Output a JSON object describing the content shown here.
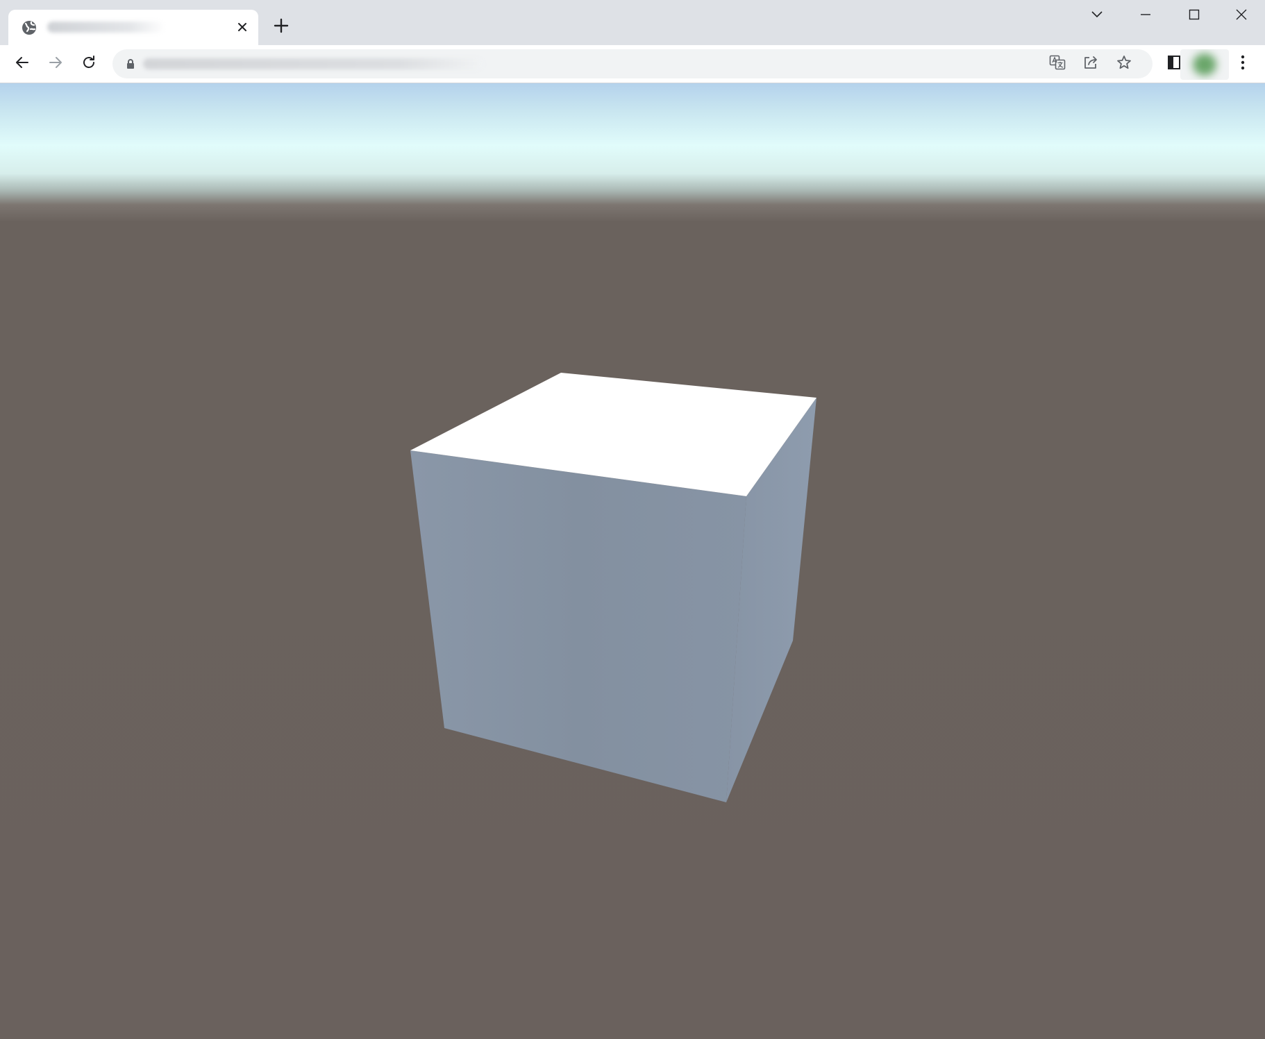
{
  "browser": {
    "tab": {
      "title": "",
      "favicon": "globe-icon",
      "close_icon": "close-icon"
    },
    "new_tab_icon": "plus-icon",
    "window_controls": [
      "tab-search-icon",
      "minimize-icon",
      "maximize-icon",
      "close-icon"
    ],
    "toolbar": {
      "back_icon": "arrow-left-icon",
      "forward_icon": "arrow-right-icon",
      "reload_icon": "reload-icon",
      "url": "",
      "lock_icon": "lock-icon",
      "omnibox_actions": [
        "translate-icon",
        "share-icon",
        "star-icon"
      ],
      "side_panel_icon": "side-panel-icon",
      "menu_icon": "kebab-menu-icon"
    }
  },
  "scene": {
    "sky_colors": [
      "#b4d2ec",
      "#e1fcfb"
    ],
    "ground_color": "#6a615d",
    "cube": {
      "top_color": "#ffffff",
      "front_color": "#8390a0",
      "right_color": "#8a98aa"
    }
  }
}
